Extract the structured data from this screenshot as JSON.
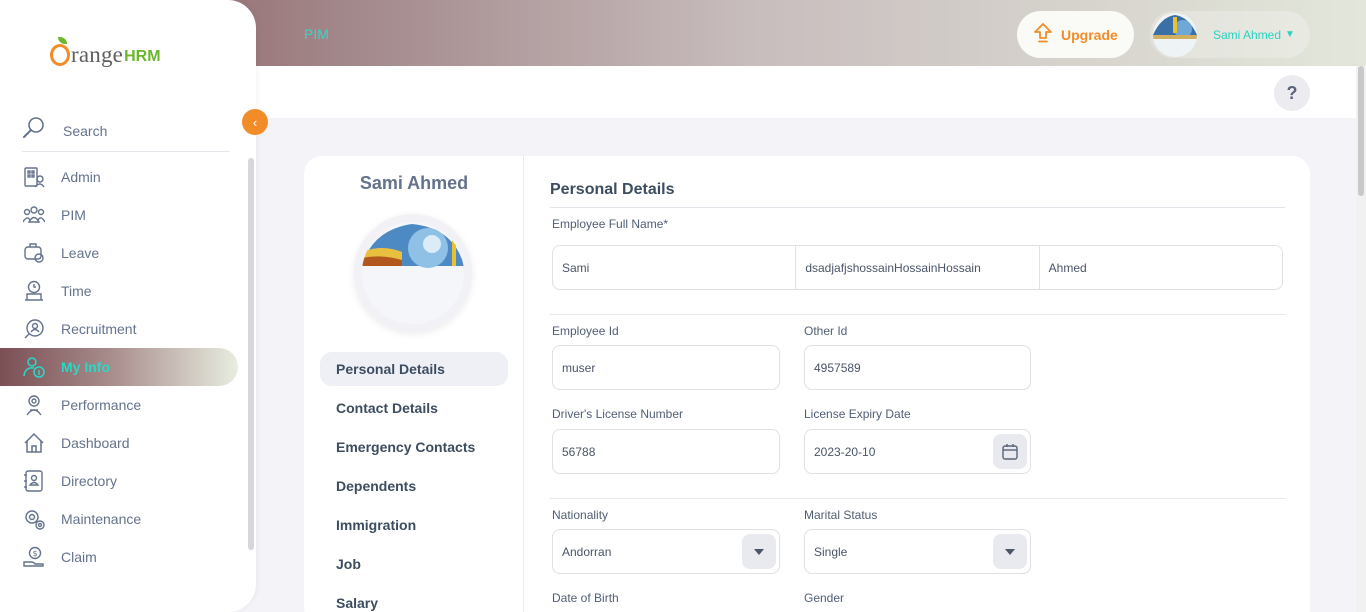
{
  "app": {
    "logo_main": "range",
    "logo_suffix": "HRM"
  },
  "topbar": {
    "breadcrumb": "PIM",
    "upgrade_label": "Upgrade",
    "user_name": "Sami Ahmed",
    "help_label": "?"
  },
  "sidebar": {
    "search_label": "Search",
    "items": [
      {
        "label": "Admin",
        "icon": "admin-icon"
      },
      {
        "label": "PIM",
        "icon": "pim-icon"
      },
      {
        "label": "Leave",
        "icon": "leave-icon"
      },
      {
        "label": "Time",
        "icon": "time-icon"
      },
      {
        "label": "Recruitment",
        "icon": "recruitment-icon"
      },
      {
        "label": "My Info",
        "icon": "my-info-icon",
        "active": true
      },
      {
        "label": "Performance",
        "icon": "performance-icon"
      },
      {
        "label": "Dashboard",
        "icon": "dashboard-icon"
      },
      {
        "label": "Directory",
        "icon": "directory-icon"
      },
      {
        "label": "Maintenance",
        "icon": "maintenance-icon"
      },
      {
        "label": "Claim",
        "icon": "claim-icon"
      }
    ]
  },
  "employee": {
    "name": "Sami Ahmed"
  },
  "tabs": [
    "Personal Details",
    "Contact Details",
    "Emergency Contacts",
    "Dependents",
    "Immigration",
    "Job",
    "Salary"
  ],
  "form": {
    "title": "Personal Details",
    "full_name_label": "Employee Full Name*",
    "first_name": "Sami",
    "middle_name": "dsadjafjshossainHossainHossain",
    "last_name": "Ahmed",
    "employee_id_label": "Employee Id",
    "employee_id": "muser",
    "other_id_label": "Other Id",
    "other_id": "4957589",
    "license_label": "Driver's License Number",
    "license": "56788",
    "expiry_label": "License Expiry Date",
    "expiry": "2023-20-10",
    "nationality_label": "Nationality",
    "nationality": "Andorran",
    "marital_label": "Marital Status",
    "marital": "Single",
    "dob_label": "Date of Birth",
    "gender_label": "Gender"
  },
  "colors": {
    "brand_orange": "#f28c28",
    "active_teal": "#28d9c8",
    "brand_green": "#6bb72c"
  }
}
